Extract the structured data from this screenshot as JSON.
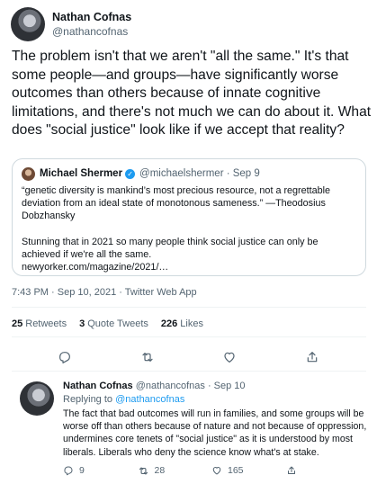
{
  "main_tweet": {
    "author_name": "Nathan Cofnas",
    "author_handle": "@nathancofnas",
    "text": "The problem isn't that we aren't \"all the same.\" It's that some people—and groups—have significantly worse outcomes than others because of innate cognitive limitations, and there's not much we can do about it. What does \"social justice\" look like if we accept that reality?",
    "quote": {
      "author_name": "Michael Shermer",
      "meta": "@michaelshermer · Sep 9",
      "paragraph1": "“genetic diversity is mankind’s most precious resource, not a regrettable deviation from an ideal state of monotonous sameness.” —Theodosius Dobzhansky",
      "paragraph2": "Stunning that in 2021 so many people think social justice can only be achieved if we're all the same.",
      "link": "newyorker.com/magazine/2021/…"
    },
    "timestamp": "7:43 PM · Sep 10, 2021 · Twitter Web App",
    "stats": {
      "retweets_count": "25",
      "retweets_label": "Retweets",
      "quote_count": "3",
      "quote_label": "Quote Tweets",
      "likes_count": "226",
      "likes_label": "Likes"
    },
    "actions": [
      "reply-icon",
      "retweet-icon",
      "like-icon",
      "share-icon"
    ]
  },
  "reply_tweet": {
    "author_name": "Nathan Cofnas",
    "meta": "@nathancofnas · Sep 10",
    "replying_prefix": "Replying to",
    "replying_handle": "@nathancofnas",
    "text": "The fact that bad outcomes will run in families, and some groups will be worse off than others because of nature and not because of oppression, undermines core tenets of \"social justice\" as it is understood by most liberals. Liberals who deny the science know what's at stake.",
    "replies": "9",
    "retweets": "28",
    "likes": "165"
  },
  "colors": {
    "text": "#0f1419",
    "secondary": "#536471",
    "accent": "#1d9bf0",
    "border": "#cfd9de"
  }
}
